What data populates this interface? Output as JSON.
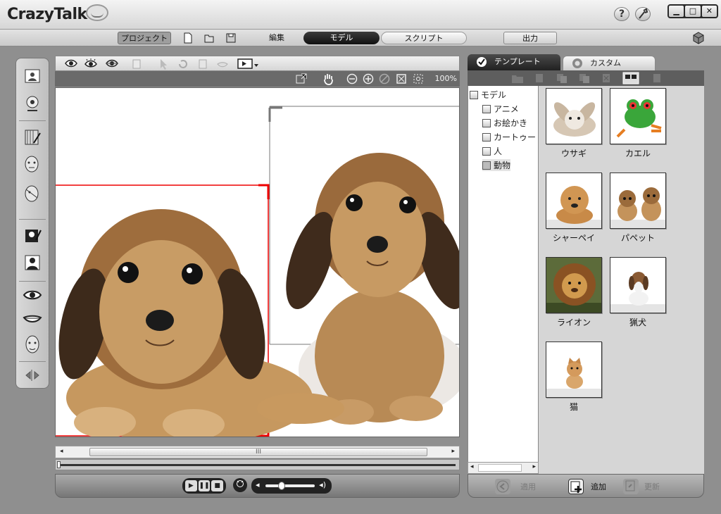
{
  "app": {
    "title": "CrazyTalk6"
  },
  "title_buttons": {
    "help": "?"
  },
  "window_controls": [
    "▁",
    "□",
    "✕"
  ],
  "menu": {
    "project": "プロジェクト",
    "edit": "編集",
    "model": "モデル",
    "script": "スクリプト",
    "output": "出力"
  },
  "viewport": {
    "zoom": "100%",
    "scroll_grip": "III"
  },
  "transport": {
    "play": "▶",
    "pause": "❚❚",
    "stop": "■"
  },
  "tabs": {
    "template": "テンプレート",
    "custom": "カスタム"
  },
  "tree": {
    "root": "モデル",
    "items": [
      "アニメ",
      "お絵かき",
      "カートゥー",
      "人",
      "動物"
    ],
    "selected": "動物"
  },
  "templates": [
    {
      "label": "ウサギ",
      "icon": "rabbit-thumbnail"
    },
    {
      "label": "カエル",
      "icon": "frog-thumbnail"
    },
    {
      "label": "シャーペイ",
      "icon": "sharpei-thumbnail"
    },
    {
      "label": "パペット",
      "icon": "puppets-thumbnail"
    },
    {
      "label": "ライオン",
      "icon": "lion-thumbnail"
    },
    {
      "label": "猟犬",
      "icon": "basset-thumbnail"
    },
    {
      "label": "猫",
      "icon": "kitten-thumbnail"
    }
  ],
  "panel_actions": {
    "apply": "適用",
    "add": "追加",
    "update": "更新"
  }
}
